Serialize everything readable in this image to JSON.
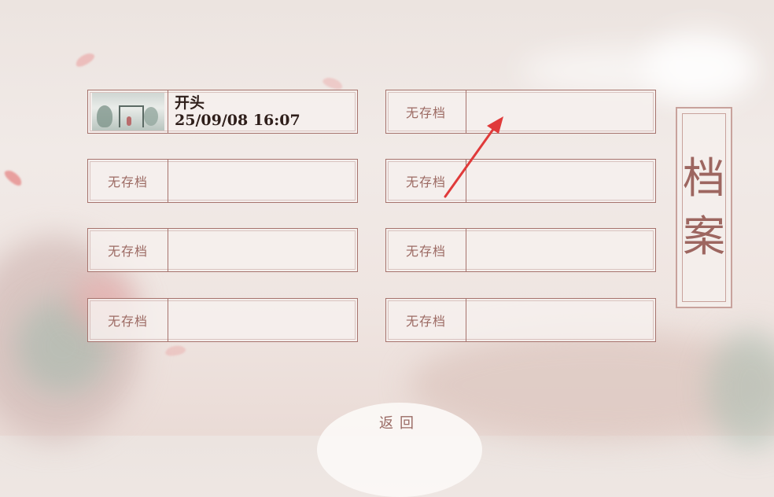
{
  "saves": {
    "slots": [
      {
        "name": "开头",
        "timestamp": "25/09/08 16:07",
        "has_save": true
      },
      {
        "empty_label": "无存档",
        "has_save": false
      },
      {
        "empty_label": "无存档",
        "has_save": false
      },
      {
        "empty_label": "无存档",
        "has_save": false
      },
      {
        "empty_label": "无存档",
        "has_save": false
      },
      {
        "empty_label": "无存档",
        "has_save": false
      },
      {
        "empty_label": "无存档",
        "has_save": false
      },
      {
        "empty_label": "无存档",
        "has_save": false
      }
    ]
  },
  "side_title": {
    "char1": "档",
    "char2": "案"
  },
  "back_button": {
    "label": "返回"
  },
  "colors": {
    "border": "#a6736d",
    "accent": "#e03a3a",
    "title": "#9d6660"
  }
}
